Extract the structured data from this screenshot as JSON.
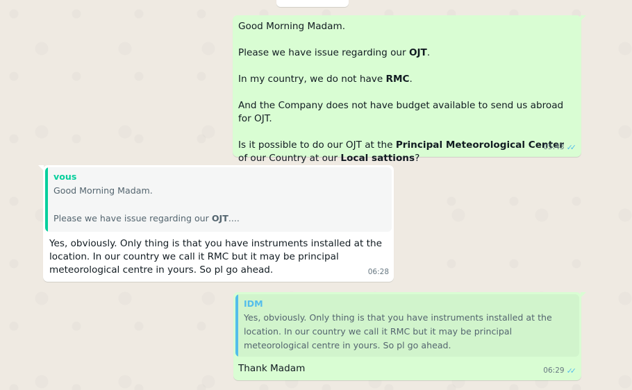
{
  "messages": [
    {
      "direction": "outgoing",
      "lines": {
        "greeting": "Good Morning Madam.",
        "issue_prefix": "Please we have issue regarding our ",
        "issue_bold": "OJT",
        "issue_suffix": ".",
        "country_prefix": "In my country, we do not have ",
        "country_bold": "RMC",
        "country_suffix": ".",
        "budget": "And the Company does not have budget available to send us abroad for OJT.",
        "question_prefix": "Is it possible to do our OJT at the ",
        "question_bold1": "Principal Meteorological Center",
        "question_mid": " of our Country at our ",
        "question_bold2": "Local sattions",
        "question_suffix": "?"
      },
      "time": "05:43",
      "status": "read"
    },
    {
      "direction": "incoming",
      "quote": {
        "author": "vous",
        "line1": "Good Morning Madam.",
        "line2_prefix": "Please we have issue regarding our ",
        "line2_bold": "OJT",
        "line2_suffix": "...."
      },
      "text": "Yes, obviously. Only thing is that you have instruments installed at the location. In our country we call it RMC but it may be principal meteorological centre in yours. So pl go ahead.",
      "time": "06:28"
    },
    {
      "direction": "outgoing",
      "quote": {
        "author": "IDM",
        "text": "Yes, obviously. Only thing is that you have instruments installed at the location. In our country we call it RMC but it may be principal meteorological centre in yours. So pl go ahead."
      },
      "text": "Thank Madam",
      "time": "06:29",
      "status": "read"
    }
  ],
  "colors": {
    "outgoing_bubble": "#d9fdd3",
    "incoming_bubble": "#ffffff",
    "chat_background": "#efeae2",
    "read_ticks": "#53bdeb",
    "quote_bar_self": "#06cf9c",
    "quote_bar_other": "#53bdeb"
  },
  "icons": {
    "read_status": "double-check-icon"
  }
}
